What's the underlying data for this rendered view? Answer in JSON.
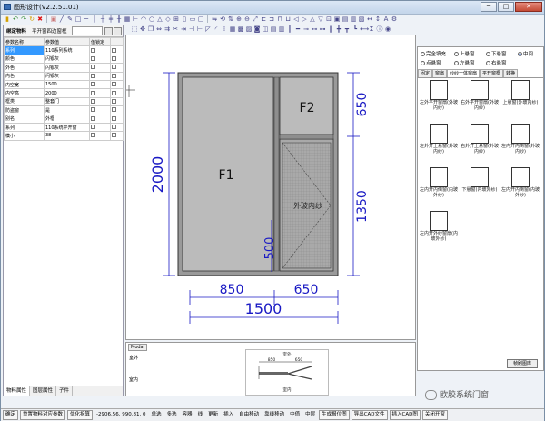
{
  "window": {
    "title": "图形设计(V2.2.51.01)",
    "min": "─",
    "max": "□",
    "close": "✕"
  },
  "left_panel": {
    "tab1": "绑定物料",
    "tab2": "平开窗四边窗框",
    "header": [
      "参数名称",
      "参数值",
      "值锁定"
    ],
    "rows": [
      {
        "name": "系列",
        "value": "110系列系统"
      },
      {
        "name": "颜色",
        "value": "闪银灰"
      },
      {
        "name": "外色",
        "value": "闪银灰"
      },
      {
        "name": "内色",
        "value": "闪银灰"
      },
      {
        "name": "内空宽",
        "value": "1500"
      },
      {
        "name": "内空高",
        "value": "2000"
      },
      {
        "name": "框类",
        "value": "整套门"
      },
      {
        "name": "防盗窗",
        "value": "是"
      },
      {
        "name": "别名",
        "value": "外框"
      },
      {
        "name": "系列",
        "value": "110系统平开窗"
      },
      {
        "name": "模小I",
        "value": "38"
      }
    ],
    "bottom_tabs": [
      "物料属性",
      "图层属性",
      "子件"
    ]
  },
  "drawing": {
    "pane1": "F1",
    "pane2": "F2",
    "pane3": "外玻内纱",
    "dim_total_width": "1500",
    "dim_left_width": "850",
    "dim_right_width": "650",
    "dim_total_height": "2000",
    "dim_top_height": "650",
    "dim_bottom_height": "1350",
    "dim_handle": "500"
  },
  "right_panel": {
    "radios": [
      "完全填充",
      "上悬窗",
      "下悬窗",
      "中间",
      "点悬窗",
      "左悬窗",
      "右悬窗"
    ],
    "tabs": [
      "固定",
      "窗扇",
      "纱纱一体窗扇",
      "平开窗框",
      "转换"
    ],
    "items": [
      "左外平开窗扇(外玻内纱)",
      "右外平开窗扇(外玻内纱)",
      "上悬窗(外玻内纱)",
      "左外开上悬窗(外玻内纱)",
      "右外开上悬窗(外玻内纱)",
      "左内开内倒窗(外玻内纱)",
      "左内开内倒窗(内玻外纱)",
      "下悬窗(内玻外纱)",
      "左内开内倒窗(内玻外纱)",
      "左内开外纱窗扇(内玻外纱)"
    ],
    "button": "帧刷图库"
  },
  "bottom_panel": {
    "tab": "Modal",
    "label1": "室外",
    "label2": "室内",
    "preview_left": "850",
    "preview_right": "650",
    "preview_top": "室外",
    "preview_bottom": "室内"
  },
  "statusbar": {
    "confirm": "确定",
    "reset": "重置物料对应参数",
    "optimize": "优化拆算",
    "coords": "-2906.56, 990.81, 0",
    "modes": [
      "单选",
      "多选",
      "容器",
      "线",
      "更新",
      "插入",
      "自由移动",
      "靠线移动",
      "中值",
      "中层"
    ],
    "generate": "生成报位图",
    "export": "导出CAD文件",
    "import": "插入CAD图",
    "close": "关闭开窗"
  },
  "watermark": "欧胶系统门窗"
}
